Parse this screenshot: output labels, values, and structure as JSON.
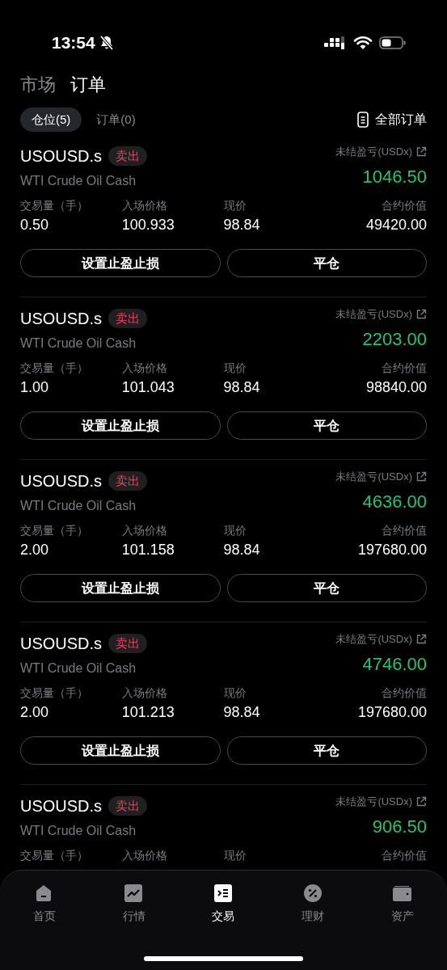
{
  "status_bar": {
    "time": "13:54",
    "silent": true
  },
  "top_tabs": [
    {
      "label": "市场",
      "selected": false
    },
    {
      "label": "订单",
      "selected": true
    }
  ],
  "sub_tabs": [
    {
      "label": "仓位(5)",
      "selected": true
    },
    {
      "label": "订单(0)",
      "selected": false
    }
  ],
  "all_orders_link": "全部订单",
  "positions": [
    {
      "symbol": "USOUSD.s",
      "side": "卖出",
      "name": "WTI Crude Oil Cash",
      "pnl_label": "未结盈亏(USDx)",
      "pnl": "1046.50",
      "labels": [
        "交易量（手）",
        "入场价格",
        "现价",
        "合约价值"
      ],
      "values": [
        "0.50",
        "100.933",
        "98.84",
        "49420.00"
      ],
      "buttons": [
        "设置止盈止损",
        "平仓"
      ]
    },
    {
      "symbol": "USOUSD.s",
      "side": "卖出",
      "name": "WTI Crude Oil Cash",
      "pnl_label": "未结盈亏(USDx)",
      "pnl": "2203.00",
      "labels": [
        "交易量（手）",
        "入场价格",
        "现价",
        "合约价值"
      ],
      "values": [
        "1.00",
        "101.043",
        "98.84",
        "98840.00"
      ],
      "buttons": [
        "设置止盈止损",
        "平仓"
      ]
    },
    {
      "symbol": "USOUSD.s",
      "side": "卖出",
      "name": "WTI Crude Oil Cash",
      "pnl_label": "未结盈亏(USDx)",
      "pnl": "4636.00",
      "labels": [
        "交易量（手）",
        "入场价格",
        "现价",
        "合约价值"
      ],
      "values": [
        "2.00",
        "101.158",
        "98.84",
        "197680.00"
      ],
      "buttons": [
        "设置止盈止损",
        "平仓"
      ]
    },
    {
      "symbol": "USOUSD.s",
      "side": "卖出",
      "name": "WTI Crude Oil Cash",
      "pnl_label": "未结盈亏(USDx)",
      "pnl": "4746.00",
      "labels": [
        "交易量（手）",
        "入场价格",
        "现价",
        "合约价值"
      ],
      "values": [
        "2.00",
        "101.213",
        "98.84",
        "197680.00"
      ],
      "buttons": [
        "设置止盈止损",
        "平仓"
      ]
    },
    {
      "symbol": "USOUSD.s",
      "side": "卖出",
      "name": "WTI Crude Oil Cash",
      "pnl_label": "未结盈亏(USDx)",
      "pnl": "906.50",
      "labels": [
        "交易量（手）",
        "入场价格",
        "现价",
        "合约价值"
      ]
    }
  ],
  "bottom_nav": [
    {
      "label": "首页",
      "selected": false
    },
    {
      "label": "行情",
      "selected": false
    },
    {
      "label": "交易",
      "selected": true
    },
    {
      "label": "理财",
      "selected": false
    },
    {
      "label": "资产",
      "selected": false
    }
  ]
}
